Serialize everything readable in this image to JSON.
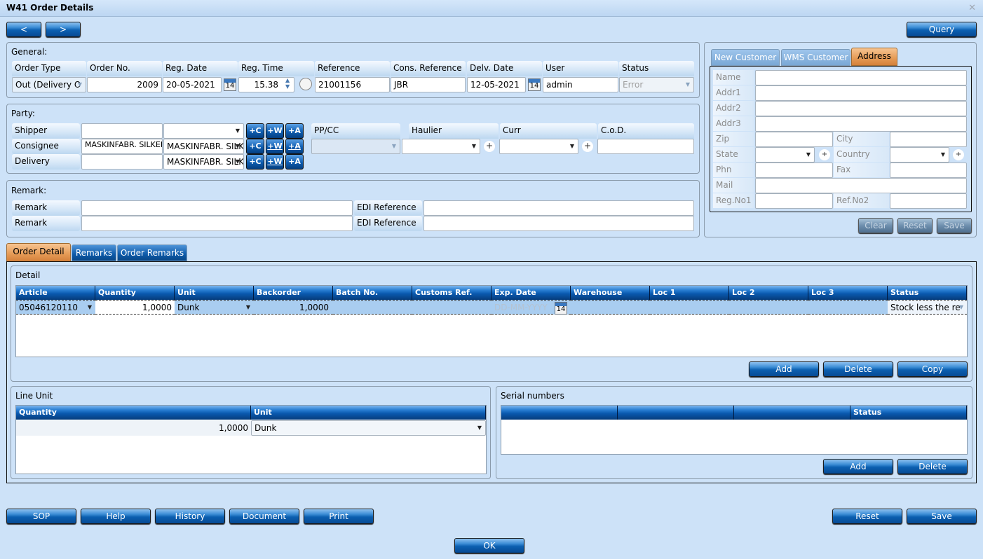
{
  "window": {
    "title": "W41 Order Details",
    "close_icon": "close-icon"
  },
  "nav": {
    "prev": "<",
    "next": ">",
    "query": "Query"
  },
  "general": {
    "label": "General:",
    "headers": [
      "Order Type",
      "Order No.",
      "Reg. Date",
      "Reg. Time",
      "Reference",
      "Cons. Reference",
      "Delv. Date",
      "User",
      "Status"
    ],
    "order_type": "Out (Delivery O",
    "order_no": "2009",
    "reg_date": "20-05-2021",
    "reg_time": "15.38",
    "reference": "21001156",
    "cons_reference": "JBR",
    "delv_date": "12-05-2021",
    "user": "admin",
    "status": "Error",
    "calendar_day": "14"
  },
  "party": {
    "label": "Party:",
    "rows": [
      {
        "label": "Shipper",
        "text": "",
        "select": ""
      },
      {
        "label": "Consignee",
        "text": "MASKINFABR. SILKEBORG",
        "select": "MASKINFABR. SILK"
      },
      {
        "label": "Delivery",
        "text": "",
        "select": "MASKINFABR. SILK"
      }
    ],
    "buttons": {
      "c": "+C",
      "w": "+W",
      "a": "+A"
    },
    "ppcc_label": "PP/CC",
    "haulier_label": "Haulier",
    "curr_label": "Curr",
    "cod_label": "C.o.D.",
    "plus": "+"
  },
  "remark": {
    "label": "Remark:",
    "rows": [
      {
        "remark_label": "Remark",
        "remark": "",
        "edi_label": "EDI Reference",
        "edi": ""
      },
      {
        "remark_label": "Remark",
        "remark": "",
        "edi_label": "EDI Reference",
        "edi": ""
      }
    ]
  },
  "address_panel": {
    "tabs": [
      "New Customer",
      "WMS Customer",
      "Address"
    ],
    "active_tab": "Address",
    "fields": {
      "name": "Name",
      "addr1": "Addr1",
      "addr2": "Addr2",
      "addr3": "Addr3",
      "zip": "Zip",
      "city": "City",
      "state": "State",
      "country": "Country",
      "phn": "Phn",
      "fax": "Fax",
      "mail": "Mail",
      "regno1": "Reg.No1",
      "refno2": "Ref.No2"
    },
    "buttons": {
      "clear": "Clear",
      "reset": "Reset",
      "save": "Save"
    }
  },
  "detail_tabs": [
    "Order Detail",
    "Remarks",
    "Order Remarks"
  ],
  "detail": {
    "label": "Detail",
    "columns": [
      "Article",
      "Quantity",
      "Unit",
      "Backorder",
      "Batch No.",
      "Customs Ref.",
      "Exp. Date",
      "Warehouse",
      "Loc 1",
      "Loc 2",
      "Loc 3",
      "Status"
    ],
    "rows": [
      {
        "article": "05046120110",
        "quantity": "1,0000",
        "unit": "Dunk",
        "backorder": "1,0000",
        "batch": "",
        "customs": "",
        "exp_date_placeholder": "DD-MM-YYYY",
        "warehouse": "",
        "loc1": "",
        "loc2": "",
        "loc3": "",
        "status": "Stock less the re"
      }
    ],
    "buttons": {
      "add": "Add",
      "delete": "Delete",
      "copy": "Copy"
    }
  },
  "line_unit": {
    "label": "Line Unit",
    "columns": [
      "Quantity",
      "Unit"
    ],
    "rows": [
      {
        "quantity": "1,0000",
        "unit": "Dunk"
      }
    ]
  },
  "serial": {
    "label": "Serial numbers",
    "columns": [
      "",
      "",
      "",
      "Status"
    ],
    "buttons": {
      "add": "Add",
      "delete": "Delete"
    }
  },
  "footer": {
    "left": [
      "SOP",
      "Help",
      "History",
      "Document",
      "Print"
    ],
    "reset": "Reset",
    "save": "Save",
    "ok": "OK"
  }
}
